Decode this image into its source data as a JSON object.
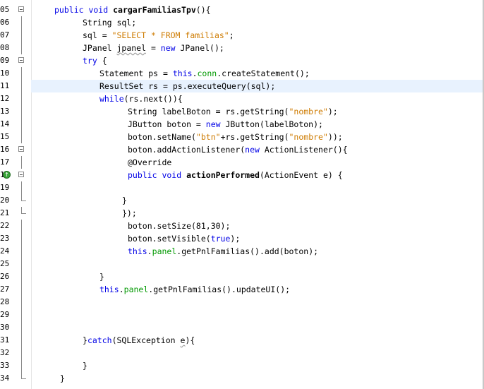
{
  "editor": {
    "lines": [
      {
        "n": "05",
        "parts": [
          {
            "t": "public void ",
            "c": "kw"
          },
          {
            "t": "cargarFamiliasTpv",
            "c": "bold"
          },
          {
            "t": "(){",
            "c": ""
          }
        ]
      },
      {
        "n": "06",
        "parts": [
          {
            "t": "String sql;",
            "c": ""
          }
        ]
      },
      {
        "n": "07",
        "parts": [
          {
            "t": "sql = ",
            "c": ""
          },
          {
            "t": "\"SELECT * FROM familias\"",
            "c": "str"
          },
          {
            "t": ";",
            "c": ""
          }
        ]
      },
      {
        "n": "08",
        "parts": [
          {
            "t": "JPanel ",
            "c": ""
          },
          {
            "t": "jpanel",
            "c": "squig"
          },
          {
            "t": " = ",
            "c": ""
          },
          {
            "t": "new",
            "c": "kw"
          },
          {
            "t": " JPanel();",
            "c": ""
          }
        ]
      },
      {
        "n": "09",
        "parts": [
          {
            "t": "try",
            "c": "kw"
          },
          {
            "t": " {",
            "c": ""
          }
        ]
      },
      {
        "n": "10",
        "parts": [
          {
            "t": "Statement ps = ",
            "c": ""
          },
          {
            "t": "this",
            "c": "kw"
          },
          {
            "t": ".",
            "c": ""
          },
          {
            "t": "conn",
            "c": "fld"
          },
          {
            "t": ".createStatement();",
            "c": ""
          }
        ]
      },
      {
        "n": "11",
        "parts": [
          {
            "t": "ResultSet rs = ps.executeQuery(sql);",
            "c": ""
          }
        ]
      },
      {
        "n": "12",
        "parts": [
          {
            "t": "while",
            "c": "kw"
          },
          {
            "t": "(rs.next()){",
            "c": ""
          }
        ]
      },
      {
        "n": "13",
        "parts": [
          {
            "t": "String labelBoton = rs.getString(",
            "c": ""
          },
          {
            "t": "\"nombre\"",
            "c": "str"
          },
          {
            "t": ");",
            "c": ""
          }
        ]
      },
      {
        "n": "14",
        "parts": [
          {
            "t": "JButton boton = ",
            "c": ""
          },
          {
            "t": "new",
            "c": "kw"
          },
          {
            "t": " JButton(labelBoton);",
            "c": ""
          }
        ]
      },
      {
        "n": "15",
        "parts": [
          {
            "t": "boton.setName(",
            "c": ""
          },
          {
            "t": "\"btn\"",
            "c": "str"
          },
          {
            "t": "+rs.getString(",
            "c": ""
          },
          {
            "t": "\"nombre\"",
            "c": "str"
          },
          {
            "t": "));",
            "c": ""
          }
        ]
      },
      {
        "n": "16",
        "parts": [
          {
            "t": "boton.addActionListener(",
            "c": ""
          },
          {
            "t": "new",
            "c": "kw"
          },
          {
            "t": " ActionListener(){",
            "c": ""
          }
        ]
      },
      {
        "n": "17",
        "parts": [
          {
            "t": "@Override",
            "c": "ann"
          }
        ]
      },
      {
        "n": "18",
        "parts": [
          {
            "t": "public void ",
            "c": "kw"
          },
          {
            "t": "actionPerformed",
            "c": "bold"
          },
          {
            "t": "(ActionEvent e) {",
            "c": ""
          }
        ]
      },
      {
        "n": "19",
        "parts": []
      },
      {
        "n": "20",
        "parts": [
          {
            "t": "}",
            "c": ""
          }
        ]
      },
      {
        "n": "21",
        "parts": [
          {
            "t": "});",
            "c": ""
          }
        ]
      },
      {
        "n": "22",
        "parts": [
          {
            "t": "boton.setSize(81,30);",
            "c": ""
          }
        ]
      },
      {
        "n": "23",
        "parts": [
          {
            "t": "boton.setVisible(",
            "c": ""
          },
          {
            "t": "true",
            "c": "kw"
          },
          {
            "t": ");",
            "c": ""
          }
        ]
      },
      {
        "n": "24",
        "parts": [
          {
            "t": "this",
            "c": "kw"
          },
          {
            "t": ".",
            "c": ""
          },
          {
            "t": "panel",
            "c": "fld"
          },
          {
            "t": ".getPnlFamilias().add(boton);",
            "c": ""
          }
        ]
      },
      {
        "n": "25",
        "parts": []
      },
      {
        "n": "26",
        "parts": [
          {
            "t": "}",
            "c": ""
          }
        ]
      },
      {
        "n": "27",
        "parts": [
          {
            "t": "this",
            "c": "kw"
          },
          {
            "t": ".",
            "c": ""
          },
          {
            "t": "panel",
            "c": "fld"
          },
          {
            "t": ".getPnlFamilias().updateUI();",
            "c": ""
          }
        ]
      },
      {
        "n": "28",
        "parts": []
      },
      {
        "n": "29",
        "parts": []
      },
      {
        "n": "30",
        "parts": []
      },
      {
        "n": "31",
        "parts": [
          {
            "t": "}",
            "c": ""
          },
          {
            "t": "catch",
            "c": "kw"
          },
          {
            "t": "(SQLException ",
            "c": ""
          },
          {
            "t": "e",
            "c": "squig"
          },
          {
            "t": "){",
            "c": ""
          }
        ]
      },
      {
        "n": "32",
        "parts": []
      },
      {
        "n": "33",
        "parts": [
          {
            "t": "}",
            "c": ""
          }
        ]
      },
      {
        "n": "34",
        "parts": [
          {
            "t": "}",
            "c": ""
          }
        ]
      }
    ]
  }
}
